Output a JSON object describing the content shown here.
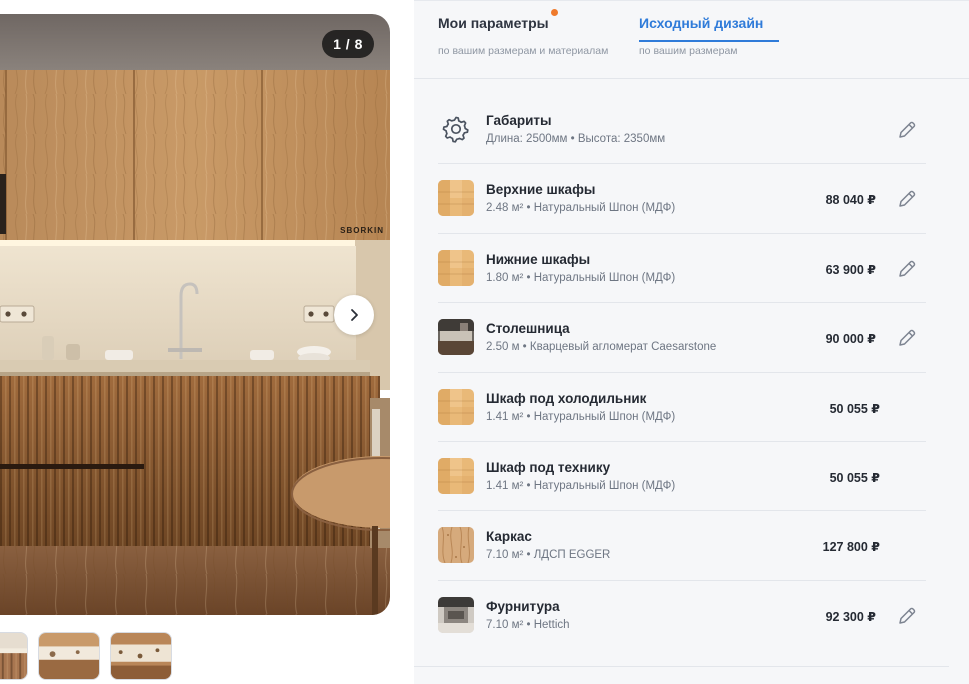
{
  "gallery": {
    "counter": "1 / 8",
    "watermark": "SBORKIN",
    "next_icon": "chevron-right-icon",
    "thumbnails": [
      "thumb-1",
      "thumb-2",
      "thumb-3"
    ]
  },
  "tabs": [
    {
      "label": "Мои параметры",
      "sub": "по вашим размерам и материалам",
      "active": false,
      "dot_color": "#ef7a2c"
    },
    {
      "label": "Исходный дизайн",
      "sub": "по вашим размерам",
      "active": true
    }
  ],
  "rows": [
    {
      "icon": "gear-icon",
      "title": "Габариты",
      "sub": "Длина: 2500мм • Высота: 2350мм",
      "price": "",
      "editable": true
    },
    {
      "icon": "wood-veneer-swatch",
      "title": "Верхние шкафы",
      "sub": "2.48 м² • Натуральный Шпон (МДФ)",
      "price": "88 040 ₽",
      "editable": true
    },
    {
      "icon": "wood-veneer-swatch",
      "title": "Нижние шкафы",
      "sub": "1.80 м² • Натуральный Шпон (МДФ)",
      "price": "63 900 ₽",
      "editable": true
    },
    {
      "icon": "countertop-photo",
      "title": "Столешница",
      "sub": "2.50 м • Кварцевый агломерат Caesarstone",
      "price": "90 000 ₽",
      "editable": true
    },
    {
      "icon": "wood-veneer-swatch",
      "title": "Шкаф под холодильник",
      "sub": "1.41 м² • Натуральный Шпон (МДФ)",
      "price": "50 055 ₽",
      "editable": false
    },
    {
      "icon": "wood-veneer-swatch",
      "title": "Шкаф под технику",
      "sub": "1.41 м² • Натуральный Шпон (МДФ)",
      "price": "50 055 ₽",
      "editable": false
    },
    {
      "icon": "chipboard-swatch",
      "title": "Каркас",
      "sub": "7.10 м² • ЛДСП EGGER",
      "price": "127 800 ₽",
      "editable": false
    },
    {
      "icon": "hardware-photo",
      "title": "Фурнитура",
      "sub": "7.10 м² • Hettich",
      "price": "92 300 ₽",
      "editable": true
    }
  ],
  "colors": {
    "accent": "#2f7bd9",
    "dot": "#ef7a2c",
    "panel_bg": "#f6f7f9",
    "text": "#252a33",
    "muted": "#6e7683"
  }
}
